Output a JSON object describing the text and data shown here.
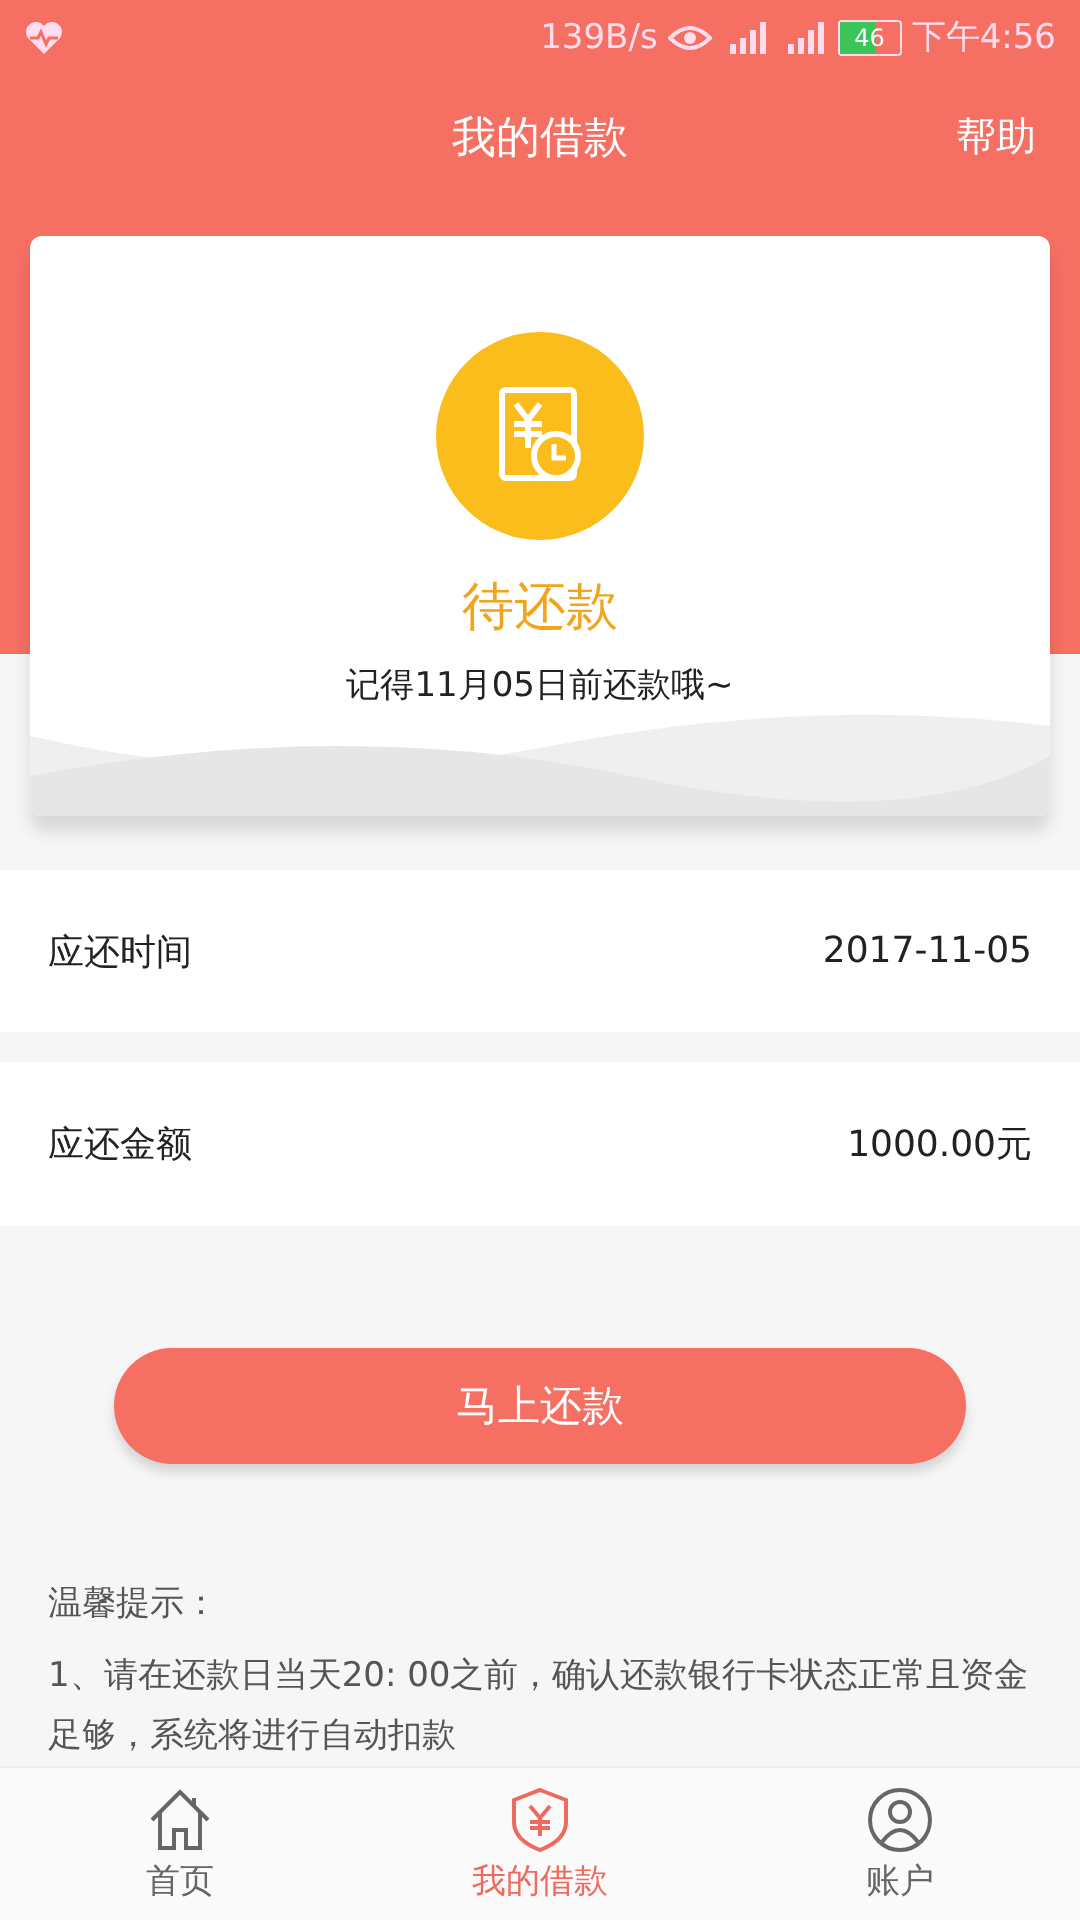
{
  "status_bar": {
    "speed": "139B/s",
    "battery": "46",
    "time": "下午4:56"
  },
  "header": {
    "title": "我的借款",
    "action": "帮助"
  },
  "status_card": {
    "status": "待还款",
    "message": "记得11月05日前还款哦~"
  },
  "rows": [
    {
      "label": "应还时间",
      "value": "2017-11-05"
    },
    {
      "label": "应还金额",
      "value": "1000.00元"
    }
  ],
  "repay_button": "马上还款",
  "tips": {
    "title": "温馨提示：",
    "items": [
      "1、请在还款日当天20: 00之前，确认还款银行卡状态正常且资金足够，系统将进行自动扣款"
    ]
  },
  "tab_bar": [
    {
      "label": "首页",
      "selected": false
    },
    {
      "label": "我的借款",
      "selected": true
    },
    {
      "label": "账户",
      "selected": false
    }
  ]
}
